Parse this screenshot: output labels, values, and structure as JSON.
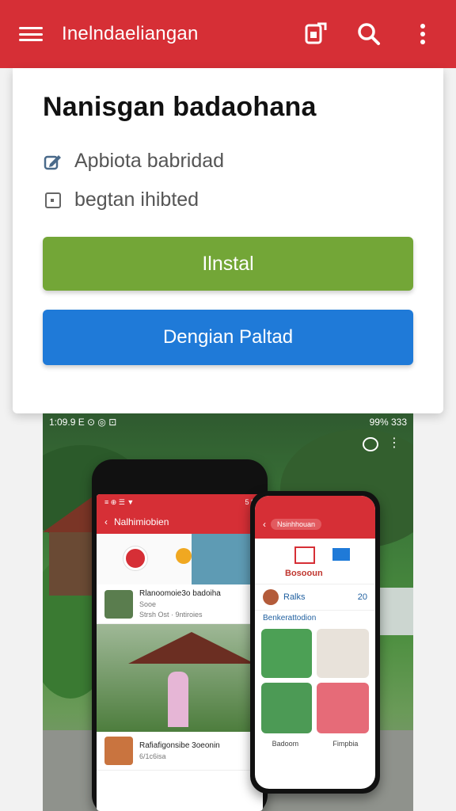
{
  "appbar": {
    "title": "Inelndaeliangan"
  },
  "card": {
    "heading": "Nanisgan badaohana",
    "rows": [
      {
        "text": "Apbiota babridad"
      },
      {
        "text": "begtan ihibted"
      }
    ],
    "install_label": "Ilnstal",
    "secondary_label": "Dengian Paltad"
  },
  "screenshot": {
    "status_left": "1:09.9 E ⊙ ◎ ⊡",
    "status_right": "99% 333",
    "phone1": {
      "status": "≡ ⊕ ☰ ▼",
      "status_right": "5 8",
      "header": "Nalhimiobien",
      "item1_title": "Rlanoomoie3o badoiha",
      "item1_sub": "Sooe",
      "item1_meta": "Strsh Ost · 9ntiroies",
      "item2_title": "Rafiafigonsibe 3oeonin",
      "item2_sub": "6/1c6isa"
    },
    "phone2": {
      "search": "Nsinhhouan",
      "banner_text": "Bosooun",
      "user_name": "Ralks",
      "user_count": "20",
      "section": "Benkerattodion",
      "caption1": "Badoom",
      "caption2": "Fimpbia"
    }
  },
  "colors": {
    "appbar": "#d62f36",
    "install": "#73a637",
    "secondary": "#1f7ad8"
  }
}
